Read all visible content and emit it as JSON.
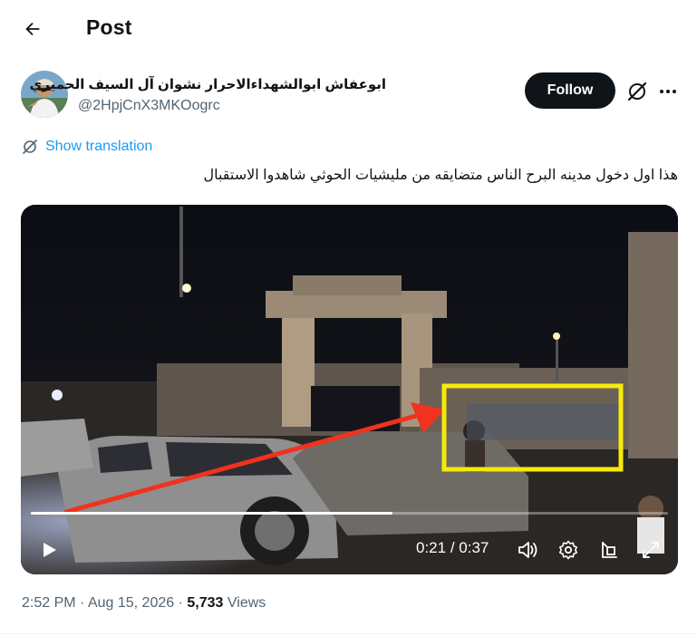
{
  "header": {
    "title": "Post"
  },
  "author": {
    "display_name": "ابوعفاش ابوالشهداءالاحرار نشوان آل السيف الحميري",
    "handle": "@2HpjCnX3MKOogrc"
  },
  "actions": {
    "follow_label": "Follow"
  },
  "translation": {
    "label": "Show translation"
  },
  "post": {
    "text": "هذا اول دخول مدينه البرح الناس متضايقه من مليشيات الحوثي شاهدوا الاستقبال"
  },
  "video": {
    "current_time": "0:21",
    "separator": "/",
    "duration": "0:37",
    "progress_fraction": 0.568
  },
  "meta": {
    "time": "2:52 PM",
    "date": "Aug 15, 2026",
    "views_count": "5,733",
    "views_label": "Views",
    "dot": "·"
  },
  "colors": {
    "accent": "#1d9bf0",
    "text": "#0f1419",
    "muted": "#536471",
    "annotation_box": "#f5ea0a",
    "annotation_arrow": "#f0321e"
  },
  "icons": [
    "back-arrow-icon",
    "grok-icon",
    "more-icon",
    "translate-icon",
    "play-icon",
    "volume-icon",
    "settings-icon",
    "pip-icon",
    "fullscreen-icon"
  ]
}
